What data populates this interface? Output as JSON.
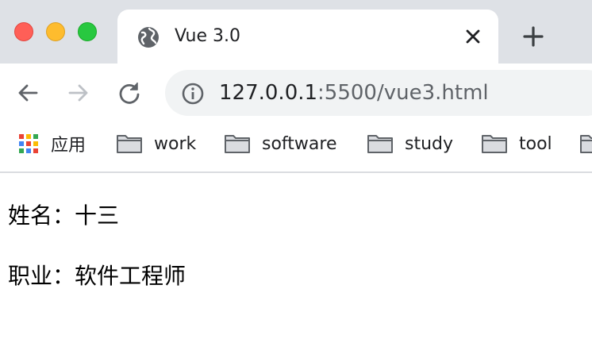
{
  "window": {
    "controls": [
      "close-icon",
      "minimize-icon",
      "maximize-icon"
    ],
    "colors": {
      "close": "#ff5f57",
      "minimize": "#febc2e",
      "maximize": "#28c840",
      "tabstrip": "#dee1e6"
    }
  },
  "tab": {
    "title": "Vue 3.0",
    "icon": "globe-icon",
    "close_icon": "close-icon"
  },
  "new_tab_icon": "plus-icon",
  "toolbar": {
    "back_icon": "arrow-left-icon",
    "forward_icon": "arrow-right-icon",
    "reload_icon": "reload-icon",
    "omnibox": {
      "info_icon": "info-icon",
      "url_host": "127.0.0.1",
      "url_rest": ":5500/vue3.html"
    }
  },
  "bookmarks": [
    {
      "label": "应用",
      "icon": "apps-grid-icon"
    },
    {
      "label": "work",
      "icon": "folder-icon"
    },
    {
      "label": "software",
      "icon": "folder-icon"
    },
    {
      "label": "study",
      "icon": "folder-icon"
    },
    {
      "label": "tool",
      "icon": "folder-icon"
    },
    {
      "label": "",
      "icon": "folder-icon"
    }
  ],
  "page": {
    "name_line": "姓名：十三",
    "job_line": "职业：软件工程师"
  }
}
